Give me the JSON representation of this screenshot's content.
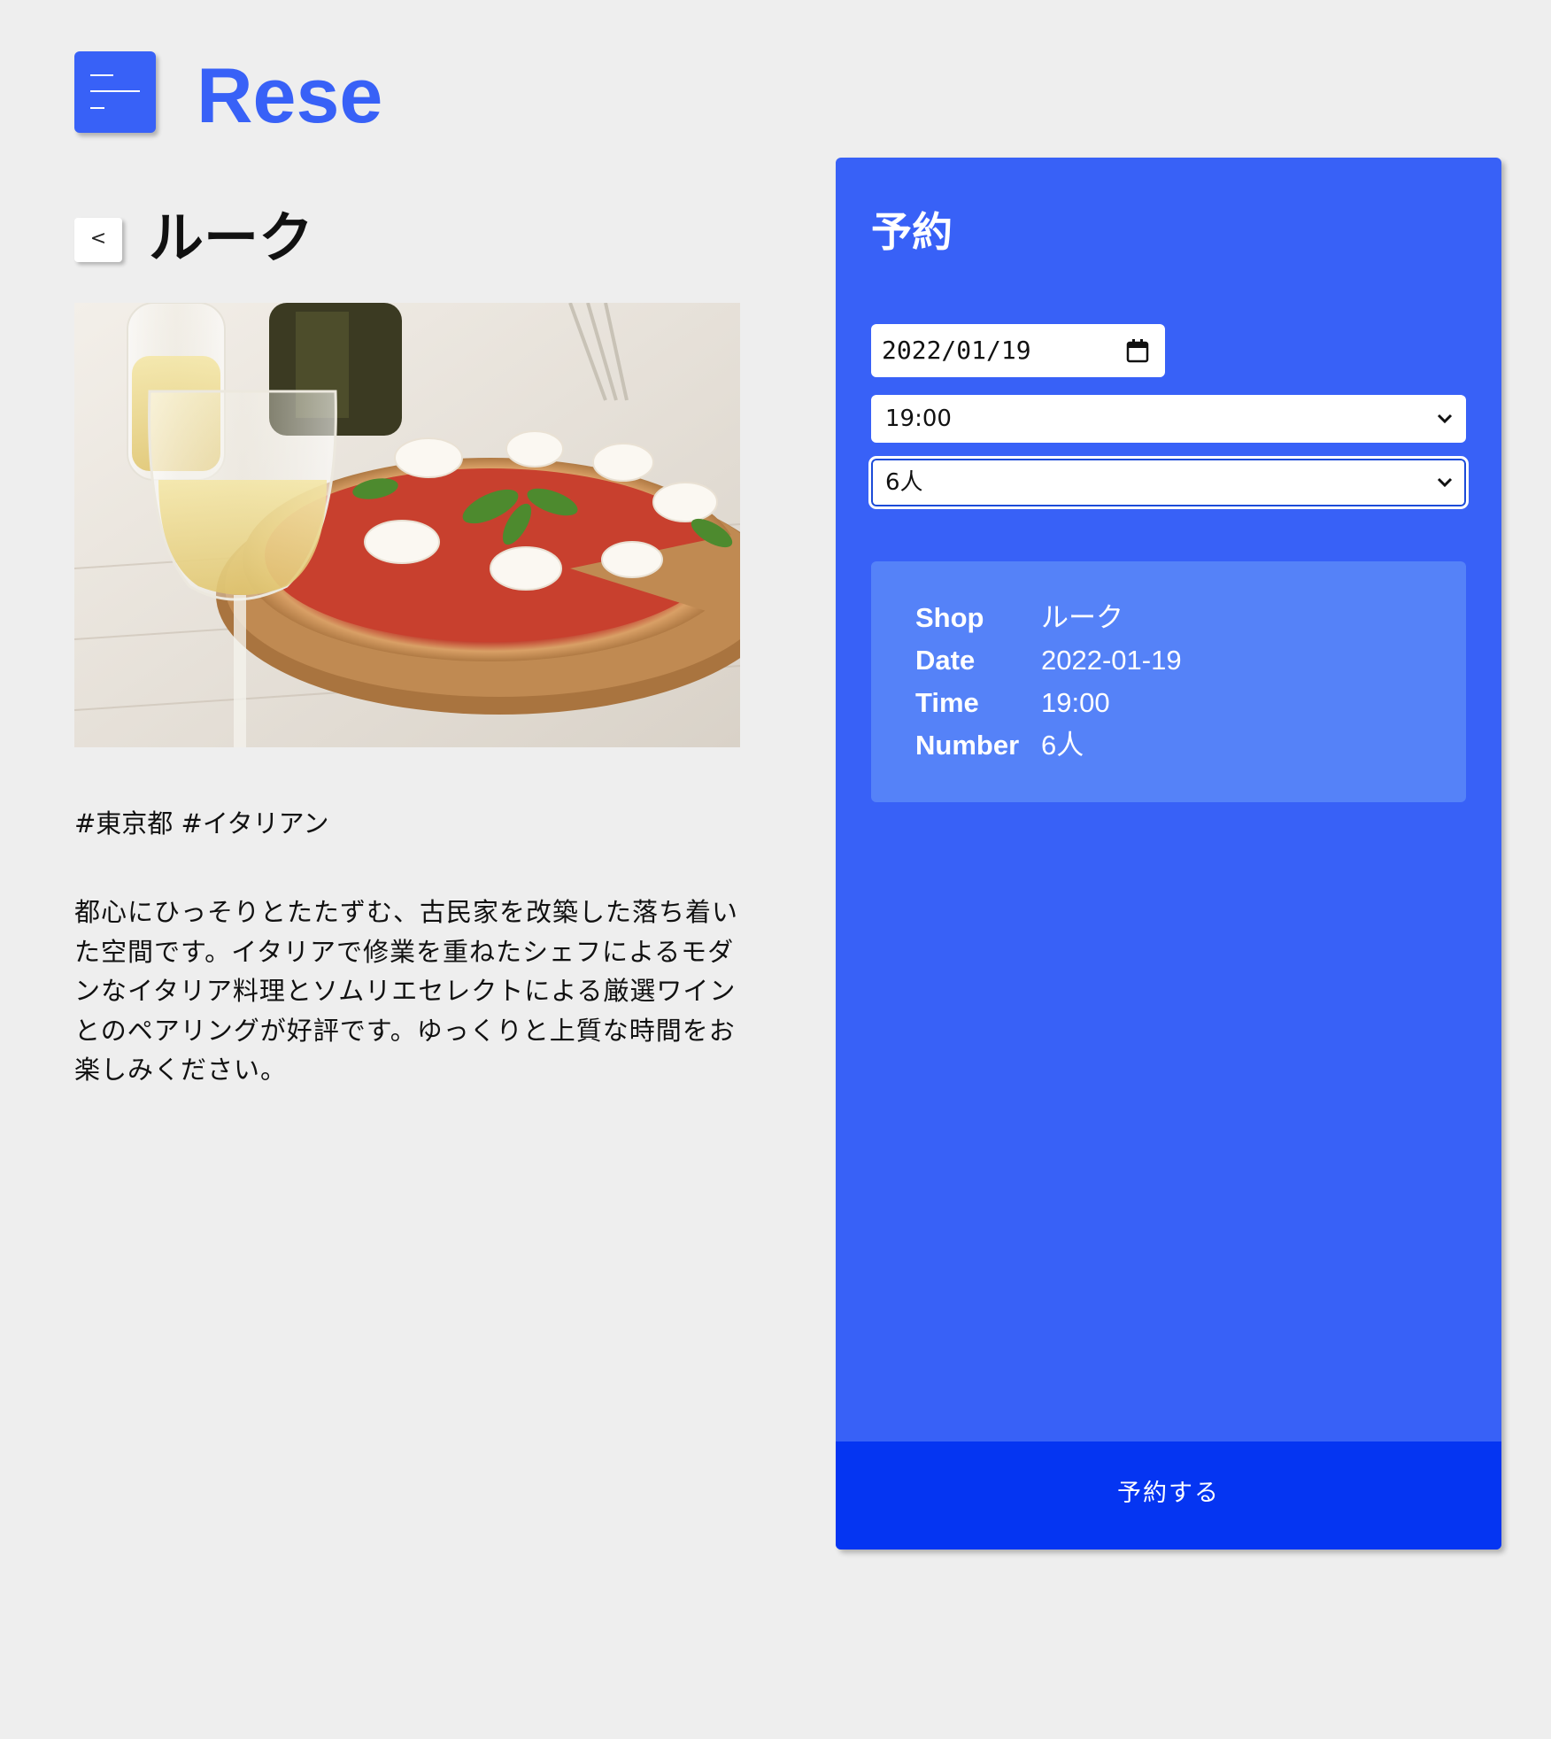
{
  "header": {
    "logo": "Rese",
    "menu_icon": "hamburger-menu-icon"
  },
  "shop": {
    "back_label": "<",
    "name": "ルーク",
    "tags": "#東京都 #イタリアン",
    "description": "都心にひっそりとたたずむ、古民家を改築した落ち着いた空間です。イタリアで修業を重ねたシェフによるモダンなイタリア料理とソムリエセレクトによる厳選ワインとのペアリングが好評です。ゆっくりと上質な時間をお楽しみください。"
  },
  "reservation": {
    "title": "予約",
    "date_value": "2022/01/19",
    "time_value": "19:00",
    "number_value": "6人",
    "summary": {
      "shop_label": "Shop",
      "shop_value": "ルーク",
      "date_label": "Date",
      "date_value": "2022-01-19",
      "time_label": "Time",
      "time_value": "19:00",
      "number_label": "Number",
      "number_value": "6人"
    },
    "submit_label": "予約する"
  },
  "colors": {
    "accent": "#3861f7",
    "button": "#0535f2",
    "summary_bg": "#5582f8",
    "background": "#eeeeee"
  }
}
